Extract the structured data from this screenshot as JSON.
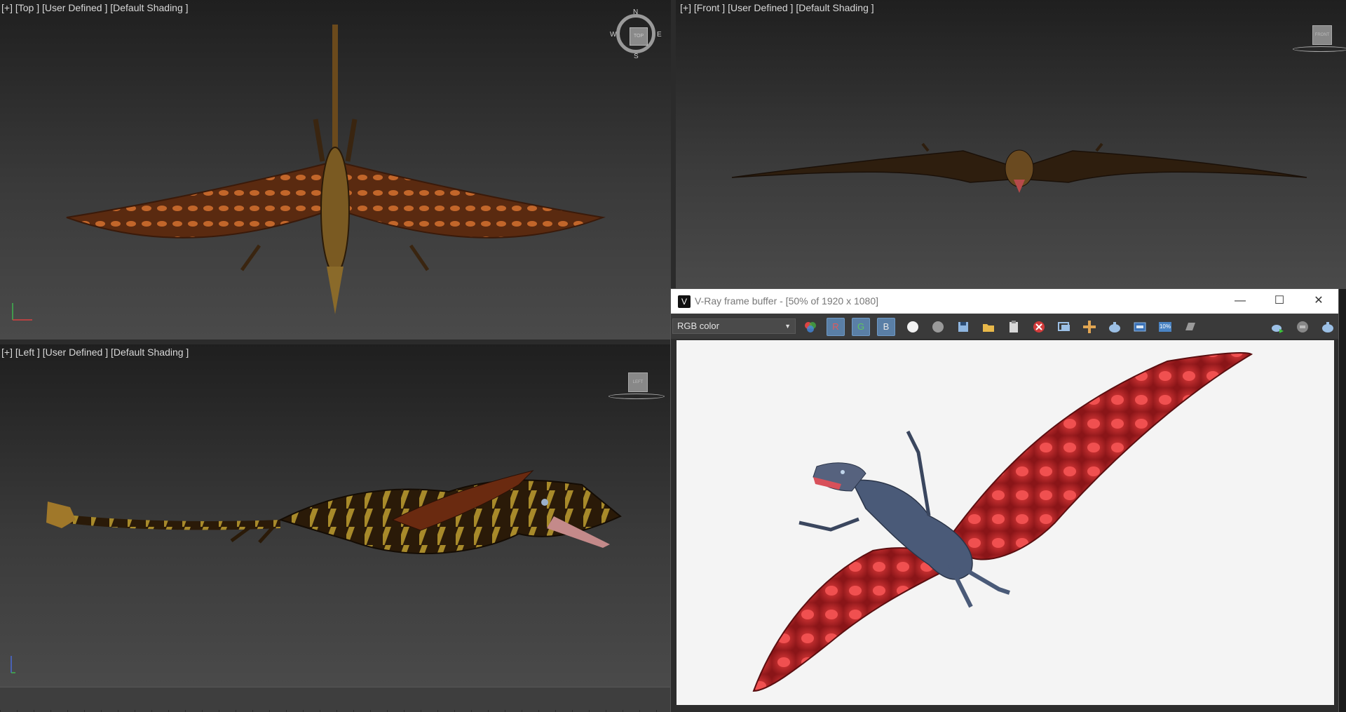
{
  "viewports": {
    "top": {
      "label": "[+] [Top ] [User Defined ] [Default Shading ]",
      "cube_label": "TOP",
      "compass": {
        "n": "N",
        "s": "S",
        "e": "E",
        "w": "W"
      }
    },
    "front": {
      "label": "[+] [Front ] [User Defined ] [Default Shading ]",
      "cube_label": "FRONT"
    },
    "left": {
      "label": "[+] [Left ] [User Defined ] [Default Shading ]",
      "cube_label": "LEFT"
    }
  },
  "vfb": {
    "title": "V-Ray frame buffer - [50% of 1920 x 1080]",
    "channel_select": "RGB color",
    "channel_buttons": {
      "r": "R",
      "g": "G",
      "b": "B"
    },
    "zoom_badge": "10%",
    "window_controls": {
      "minimize": "—",
      "maximize": "☐",
      "close": "✕"
    }
  },
  "colors": {
    "viewport_top": "#1f1f1f",
    "viewport_bottom": "#4a4a4a",
    "vfb_background": "#f4f4f4",
    "toolbar_active": "#5a7fa6",
    "render_wing": "#c4242a",
    "render_body": "#4a5a78"
  }
}
